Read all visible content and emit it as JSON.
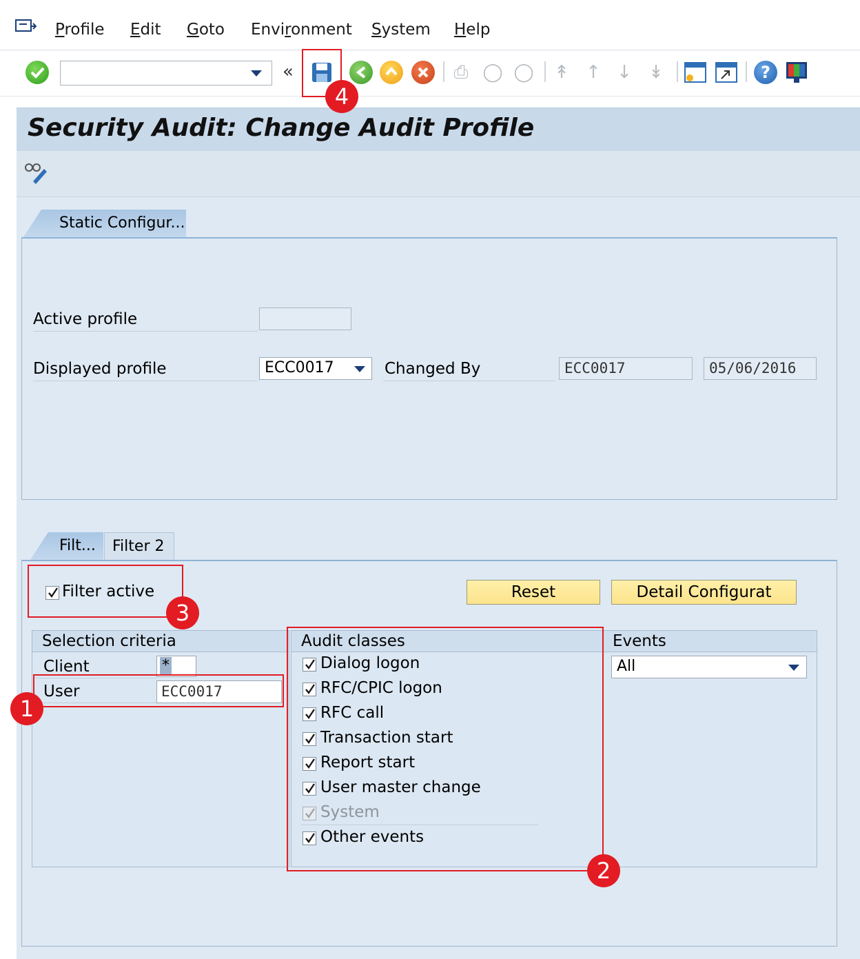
{
  "menu": {
    "items": [
      {
        "u": "P",
        "rest": "rofile"
      },
      {
        "u": "E",
        "rest": "dit"
      },
      {
        "u": "G",
        "rest": "oto"
      },
      {
        "pre": "Envi",
        "u": "r",
        "rest": "onment"
      },
      {
        "u": "S",
        "rest": "ystem"
      },
      {
        "u": "H",
        "rest": "elp"
      }
    ]
  },
  "toolbar": {
    "command_value": "",
    "back_label": "«"
  },
  "page": {
    "title": "Security Audit: Change Audit Profile"
  },
  "tabs_top": {
    "static_config": "Static Configur..."
  },
  "static": {
    "active_profile_label": "Active profile",
    "active_profile_value": "",
    "displayed_profile_label": "Displayed profile",
    "displayed_profile_value": "ECC0017",
    "changed_by_label": "Changed By",
    "changed_by_value": "ECC0017",
    "changed_date": "05/06/2016"
  },
  "tabs_filter": {
    "filter1": "Filt...",
    "filter2": "Filter 2"
  },
  "filter": {
    "filter_active_label": "Filter active",
    "filter_active_checked": true,
    "reset_label": "Reset",
    "detail_label": "Detail Configurat",
    "selection": {
      "heading": "Selection criteria",
      "client_label": "Client",
      "client_value": "*",
      "user_label": "User",
      "user_value": "ECC0017"
    },
    "audit_classes": {
      "heading": "Audit classes",
      "items": [
        {
          "label": "Dialog logon",
          "checked": true,
          "disabled": false
        },
        {
          "label": "RFC/CPIC logon",
          "checked": true,
          "disabled": false
        },
        {
          "label": "RFC call",
          "checked": true,
          "disabled": false
        },
        {
          "label": "Transaction start",
          "checked": true,
          "disabled": false
        },
        {
          "label": "Report start",
          "checked": true,
          "disabled": false
        },
        {
          "label": "User master change",
          "checked": true,
          "disabled": false
        },
        {
          "label": "System",
          "checked": true,
          "disabled": true
        },
        {
          "label": "Other events",
          "checked": true,
          "disabled": false
        }
      ]
    },
    "events": {
      "heading": "Events",
      "value": "All"
    }
  },
  "annotations": {
    "n1": "1",
    "n2": "2",
    "n3": "3",
    "n4": "4"
  },
  "colors": {
    "accent_red": "#e31b23",
    "button_yellow": "#fbe38c",
    "panel_blue": "#dee9f3"
  }
}
